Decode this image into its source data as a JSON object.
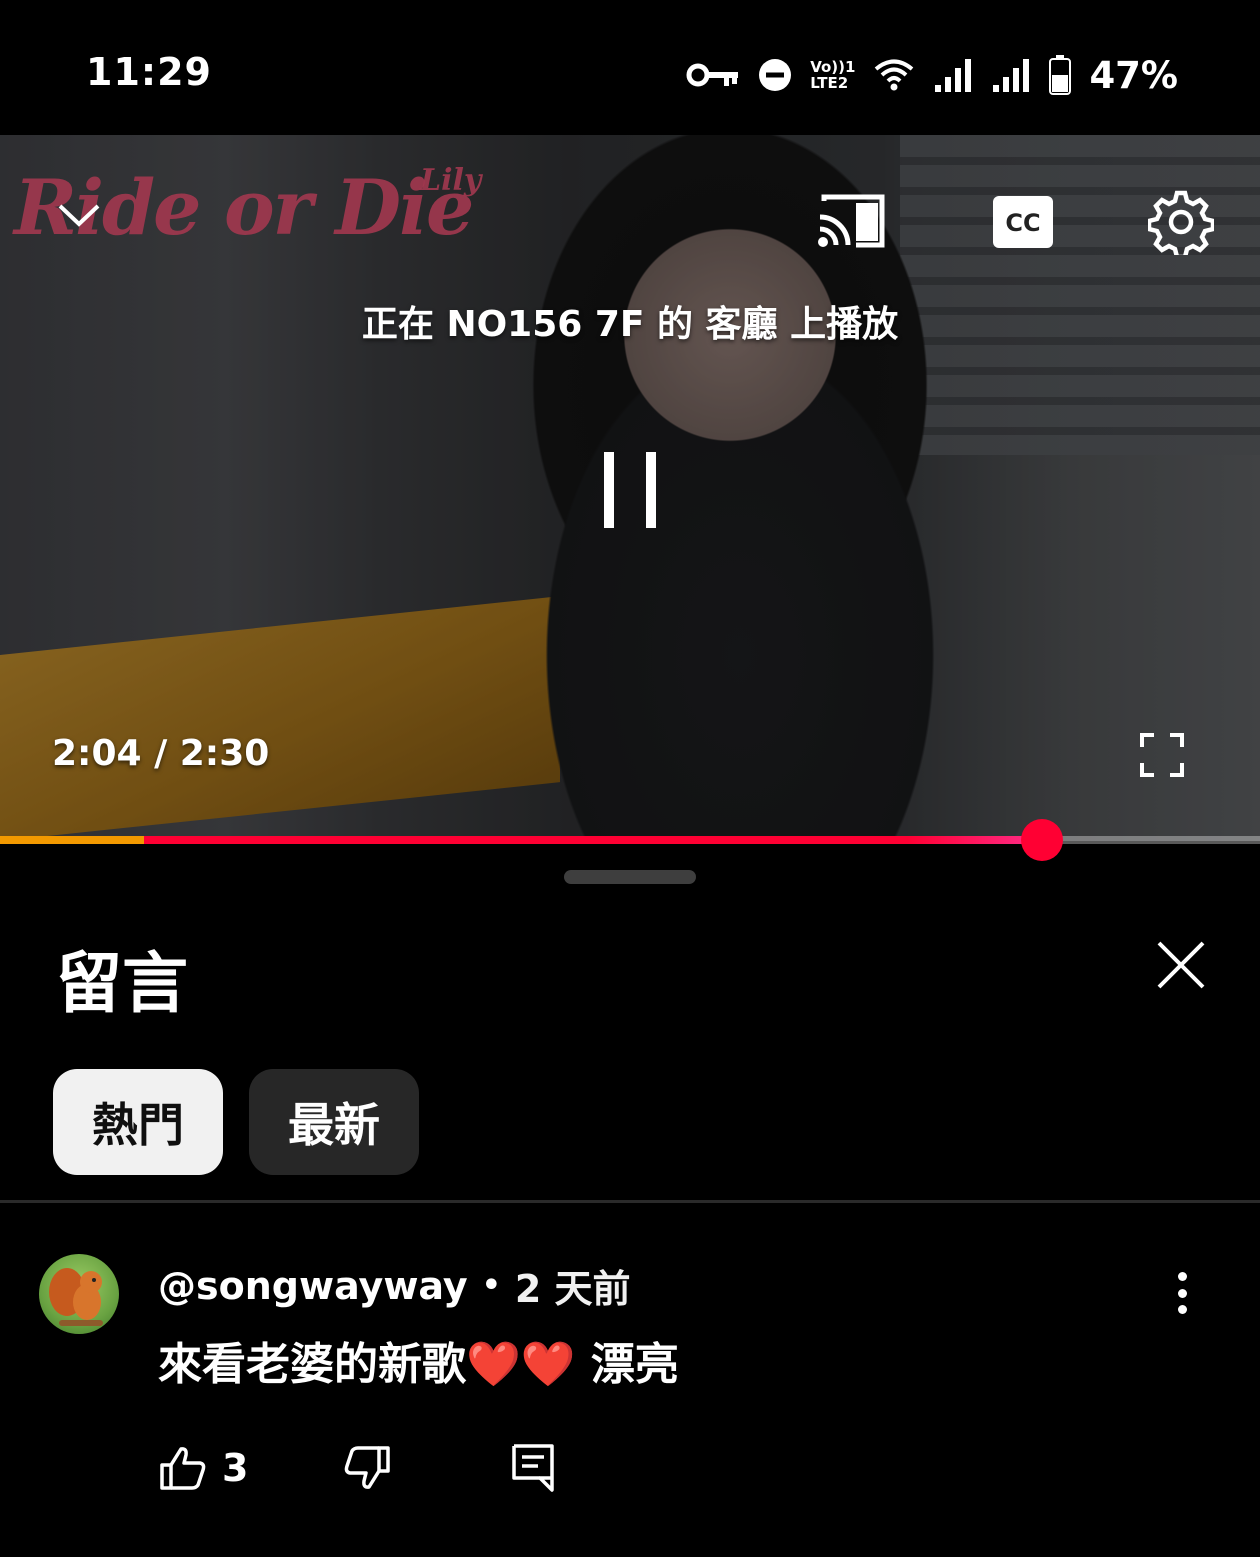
{
  "status_bar": {
    "time": "11:29",
    "battery": "47%",
    "icons": [
      "vpn-key-icon",
      "do-not-disturb-icon",
      "volte-icon",
      "wifi-icon",
      "signal-icon",
      "signal-icon",
      "battery-icon"
    ],
    "volte_label_1": "Vo))1",
    "volte_label_2": "LTE2"
  },
  "video": {
    "overlay_logo": "Ride or Die",
    "overlay_logo_sub": "Lily",
    "cast_status": "正在 NO156 7F 的 客廳 上播放",
    "time_display": "2:04 / 2:30",
    "progress_fraction": 0.8267,
    "buffer_start_fraction": 0.1143,
    "icons": {
      "collapse": "chevron-down-icon",
      "cast": "cast-icon",
      "captions": "captions-icon",
      "settings": "gear-icon",
      "pause": "pause-icon",
      "fullscreen": "fullscreen-icon"
    },
    "colors": {
      "played": "#ff0033",
      "buffer": "#f29900"
    }
  },
  "comments": {
    "title": "留言",
    "filters": [
      {
        "label": "熱門",
        "selected": true
      },
      {
        "label": "最新",
        "selected": false
      }
    ],
    "items": [
      {
        "author": "@songwayway",
        "separator": "•",
        "time": "2 天前",
        "text": "來看老婆的新歌❤️❤️ 漂亮",
        "likes": "3"
      }
    ]
  }
}
